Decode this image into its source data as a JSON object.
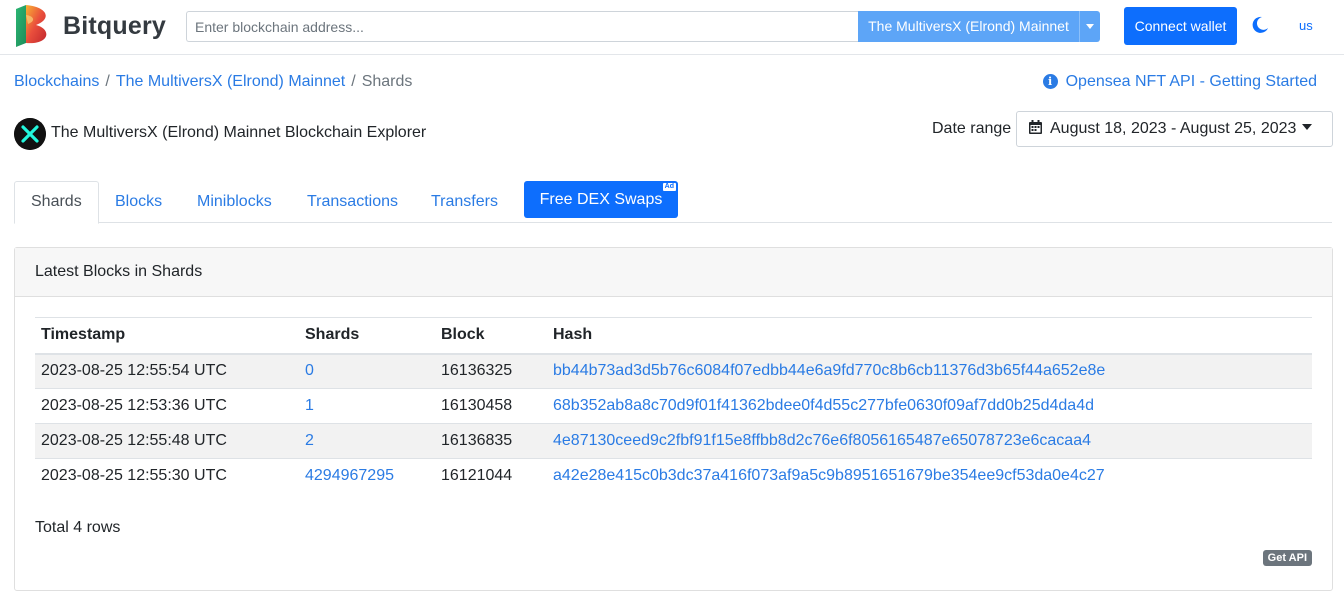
{
  "header": {
    "brand": "Bitquery",
    "search_placeholder": "Enter blockchain address...",
    "network_selected": "The MultiversX (Elrond) Mainnet",
    "connect_wallet": "Connect wallet",
    "language": "us"
  },
  "breadcrumb": {
    "items": [
      "Blockchains",
      "The MultiversX (Elrond) Mainnet",
      "Shards"
    ],
    "separator": "/"
  },
  "promo_link": "Opensea NFT API - Getting Started",
  "explorer": {
    "title": "The MultiversX (Elrond) Mainnet Blockchain Explorer",
    "date_range_label": "Date range",
    "date_range_value": "August 18, 2023 - August 25, 2023"
  },
  "tabs": [
    {
      "label": "Shards",
      "active": true
    },
    {
      "label": "Blocks",
      "active": false
    },
    {
      "label": "Miniblocks",
      "active": false
    },
    {
      "label": "Transactions",
      "active": false
    },
    {
      "label": "Transfers",
      "active": false
    }
  ],
  "dex_button": {
    "label": "Free DEX Swaps",
    "badge": "Ad"
  },
  "card": {
    "title": "Latest Blocks in Shards",
    "columns": [
      "Timestamp",
      "Shards",
      "Block",
      "Hash"
    ],
    "rows": [
      {
        "timestamp": "2023-08-25 12:55:54 UTC",
        "shard": "0",
        "block": "16136325",
        "hash": "bb44b73ad3d5b76c6084f07edbb44e6a9fd770c8b6cb11376d3b65f44a652e8e"
      },
      {
        "timestamp": "2023-08-25 12:53:36 UTC",
        "shard": "1",
        "block": "16130458",
        "hash": "68b352ab8a8c70d9f01f41362bdee0f4d55c277bfe0630f09af7dd0b25d4da4d"
      },
      {
        "timestamp": "2023-08-25 12:55:48 UTC",
        "shard": "2",
        "block": "16136835",
        "hash": "4e87130ceed9c2fbf91f15e8ffbb8d2c76e6f8056165487e65078723e6cacaa4"
      },
      {
        "timestamp": "2023-08-25 12:55:30 UTC",
        "shard": "4294967295",
        "block": "16121044",
        "hash": "a42e28e415c0b3dc37a416f073af9a5c9b8951651679be354ee9cf53da0e4c27"
      }
    ],
    "total": "Total 4 rows",
    "get_api": "Get API"
  },
  "colors": {
    "primary": "#0d6efd",
    "link": "#2a7be4",
    "network_select": "#5da5f7"
  }
}
